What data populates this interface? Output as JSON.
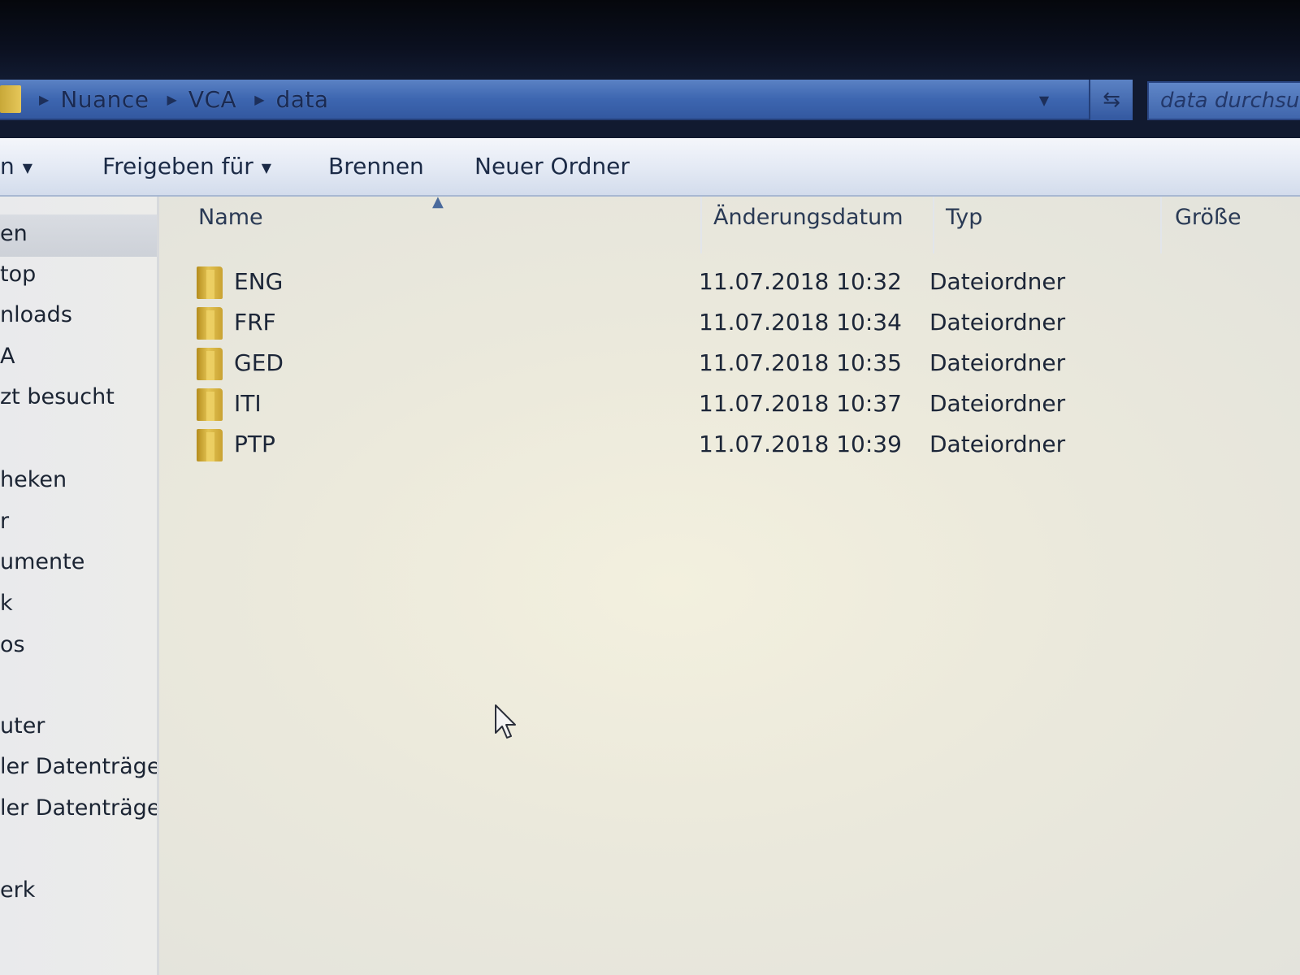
{
  "breadcrumb": {
    "items": [
      "Nuance",
      "VCA",
      "data"
    ]
  },
  "search": {
    "placeholder": "data durchsuchen"
  },
  "toolbar": {
    "partial_label": "n",
    "share_label": "Freigeben für",
    "burn_label": "Brennen",
    "new_folder_label": "Neuer Ordner"
  },
  "sidebar": {
    "items": [
      "en",
      "top",
      "nloads",
      "A",
      "zt besucht",
      "heken",
      "r",
      "umente",
      "k",
      "os",
      "uter",
      "ler Datenträger",
      "ler Datenträger",
      "erk"
    ]
  },
  "columns": {
    "name": "Name",
    "date": "Änderungsdatum",
    "type": "Typ",
    "size": "Größe"
  },
  "files": [
    {
      "name": "ENG",
      "date": "11.07.2018 10:32",
      "type": "Dateiordner"
    },
    {
      "name": "FRF",
      "date": "11.07.2018 10:34",
      "type": "Dateiordner"
    },
    {
      "name": "GED",
      "date": "11.07.2018 10:35",
      "type": "Dateiordner"
    },
    {
      "name": "ITI",
      "date": "11.07.2018 10:37",
      "type": "Dateiordner"
    },
    {
      "name": "PTP",
      "date": "11.07.2018 10:39",
      "type": "Dateiordner"
    }
  ],
  "icons": {
    "folder": "folder-icon",
    "refresh": "refresh-icon",
    "cursor": "mouse-pointer-icon"
  },
  "colors": {
    "address_bar": "#3d66b0",
    "folder": "#e3c352",
    "text": "#1c2638"
  }
}
